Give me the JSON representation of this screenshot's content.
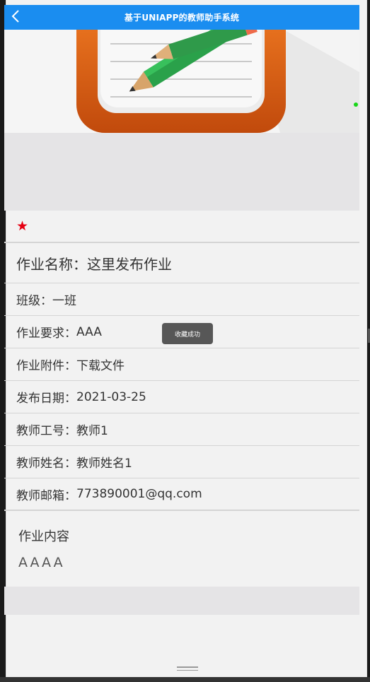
{
  "navbar": {
    "back_icon": "chevron-left-icon",
    "title": "基于UNIAPP的教师助手系统",
    "color": "#1a8df0"
  },
  "hero": {
    "image": "notebook-pencil-app-icon",
    "carousel_active_color": "#18d618"
  },
  "favorite": {
    "icon": "star-icon",
    "color": "#e60012"
  },
  "details": {
    "title": "作业名称：这里发布作业",
    "rows": [
      {
        "label": "班级：",
        "value": "一班"
      },
      {
        "label": "作业要求：",
        "value": "AAA"
      },
      {
        "label": "作业附件：",
        "value": "下载文件"
      },
      {
        "label": "发布日期：",
        "value": "2021-03-25"
      },
      {
        "label": "教师工号：",
        "value": "教师1"
      },
      {
        "label": "教师姓名：",
        "value": "教师姓名1"
      },
      {
        "label": "教师邮箱：",
        "value": "773890001@qq.com"
      }
    ]
  },
  "content": {
    "title": "作业内容",
    "text": "AAAA"
  },
  "toast": {
    "text": "收藏成功"
  }
}
